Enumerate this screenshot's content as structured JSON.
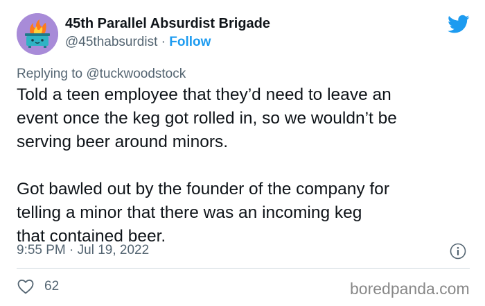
{
  "author": {
    "display_name": "45th Parallel Absurdist Brigade",
    "handle": "@45thabsurdist",
    "separator": "·",
    "follow_label": "Follow",
    "avatar_icon": "burning-dumpster-avatar"
  },
  "brand_icon": "twitter-bird-icon",
  "reply": {
    "text": "Replying to @tuckwoodstock"
  },
  "tweet": {
    "paragraphs": [
      [
        "Told a teen employee that they’d need to leave an",
        "event once the keg got rolled in, so we wouldn’t be",
        "serving beer around minors."
      ],
      [
        "Got bawled out by the founder of the company for",
        "telling a minor that there was an incoming keg",
        "that contained beer."
      ]
    ],
    "timestamp": "9:55 PM · Jul 19, 2022"
  },
  "engagement": {
    "like_icon": "heart-icon",
    "like_count": "62",
    "info_icon": "info-icon"
  },
  "watermark": "boredpanda.com",
  "colors": {
    "accent": "#1d9bf0",
    "text": "#0f1419",
    "muted": "#536471",
    "divider": "#cfd9de",
    "avatar_bg": "#a88bd8"
  }
}
